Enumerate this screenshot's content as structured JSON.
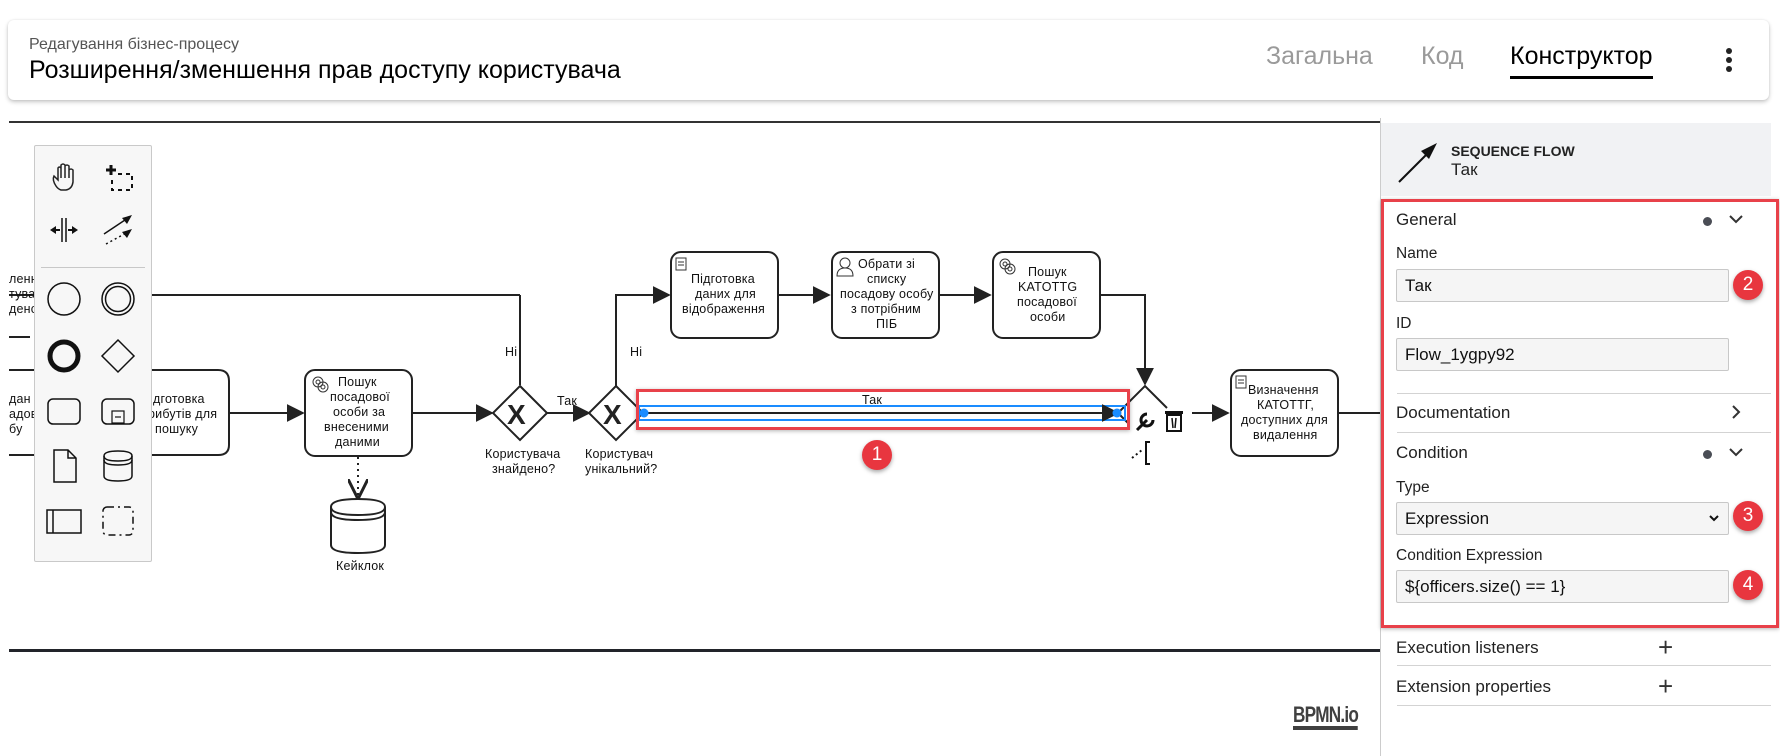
{
  "header": {
    "subtitle": "Редагування бізнес-процесу",
    "title": "Розширення/зменшення прав доступу користувача",
    "tabs": [
      {
        "label": "Загальна",
        "active": false
      },
      {
        "label": "Код",
        "active": false
      },
      {
        "label": "Конструктор",
        "active": true
      }
    ],
    "more_icon": "kebab-vertical-icon"
  },
  "palette": {
    "tools": [
      "hand-tool",
      "lasso-tool",
      "space-tool",
      "global-connect-tool"
    ],
    "shapes": [
      "start-event",
      "intermediate-event",
      "end-event",
      "gateway",
      "task",
      "subprocess",
      "data-object",
      "data-store",
      "pool",
      "group"
    ]
  },
  "diagram": {
    "tasks": {
      "left_cut_top": [
        "ленн",
        "тува",
        "денс"
      ],
      "left_cut_mid": [
        "дан",
        "адов",
        "бу"
      ],
      "prepare_attrs": [
        "ідготовка",
        "рибутів для",
        "пошуку"
      ],
      "search_officer": [
        "Пошук",
        "посадової",
        "особи за",
        "внесеними",
        "даними"
      ],
      "prepare_display": [
        "Підготовка",
        "даних для",
        "відображення"
      ],
      "choose_officer": [
        "Обрати зі",
        "списку",
        "посадову особу",
        "з потрібним",
        "ПІБ"
      ],
      "search_katottg": [
        "Пошук",
        "KATOTTG",
        "посадової",
        "особи"
      ],
      "define_katottg": [
        "Визначення",
        "КАТОТТГ,",
        "доступних для",
        "видалення"
      ]
    },
    "datastore_label": "Кейклок",
    "gateways": {
      "user_found": [
        "Користувача",
        "знайдено?"
      ],
      "user_unique": [
        "Користувач",
        "унікальний?"
      ]
    },
    "flow_labels": {
      "no1": "Ні",
      "no2": "Ні",
      "yes1": "Так",
      "selected": "Так"
    },
    "watermark": "BPMN.io"
  },
  "panel": {
    "element_type": "SEQUENCE FLOW",
    "element_name": "Так",
    "general": {
      "title": "General",
      "name_label": "Name",
      "name_value": "Так",
      "id_label": "ID",
      "id_value": "Flow_1ygpy92"
    },
    "documentation": {
      "title": "Documentation"
    },
    "condition": {
      "title": "Condition",
      "type_label": "Type",
      "type_value": "Expression",
      "expr_label": "Condition Expression",
      "expr_value": "${officers.size() == 1}"
    },
    "execution_listeners": {
      "title": "Execution listeners"
    },
    "extension_properties": {
      "title": "Extension properties"
    }
  },
  "annotations": [
    "1",
    "2",
    "3",
    "4"
  ],
  "colors": {
    "highlight": "#e8414a",
    "selection": "#1a8cff",
    "badge": "#e8363f",
    "panel_header_bg": "#f1f2f4"
  }
}
